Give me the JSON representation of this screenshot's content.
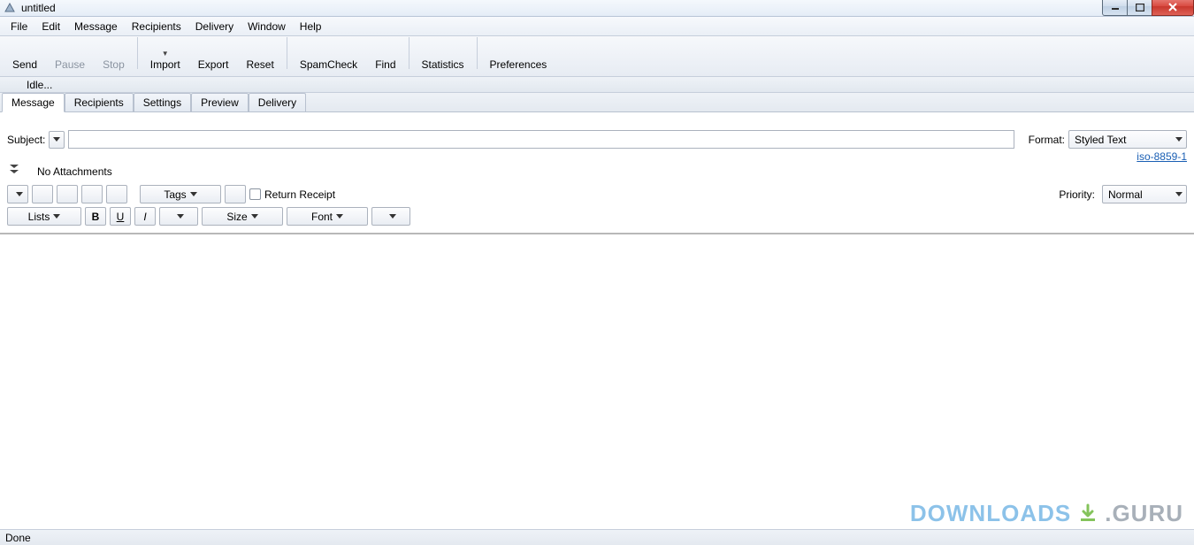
{
  "window": {
    "title": "untitled"
  },
  "menu": {
    "items": [
      "File",
      "Edit",
      "Message",
      "Recipients",
      "Delivery",
      "Window",
      "Help"
    ]
  },
  "toolbar": {
    "send": "Send",
    "pause": "Pause",
    "stop": "Stop",
    "import": "Import",
    "export": "Export",
    "reset": "Reset",
    "spamcheck": "SpamCheck",
    "find": "Find",
    "statistics": "Statistics",
    "preferences": "Preferences"
  },
  "status_strip": "Idle...",
  "tabs": [
    "Message",
    "Recipients",
    "Settings",
    "Preview",
    "Delivery"
  ],
  "form": {
    "subject_label": "Subject:",
    "subject_value": "",
    "format_label": "Format:",
    "format_value": "Styled Text",
    "encoding_link": "iso-8859-1",
    "no_attachments": "No Attachments",
    "tags_label": "Tags",
    "return_receipt": "Return Receipt",
    "priority_label": "Priority:",
    "priority_value": "Normal",
    "lists_label": "Lists",
    "bold": "B",
    "underline": "U",
    "italic": "I",
    "size_label": "Size",
    "font_label": "Font"
  },
  "bottom_status": "Done",
  "watermark": {
    "left": "DOWNLOADS",
    "right": ".GURU"
  }
}
